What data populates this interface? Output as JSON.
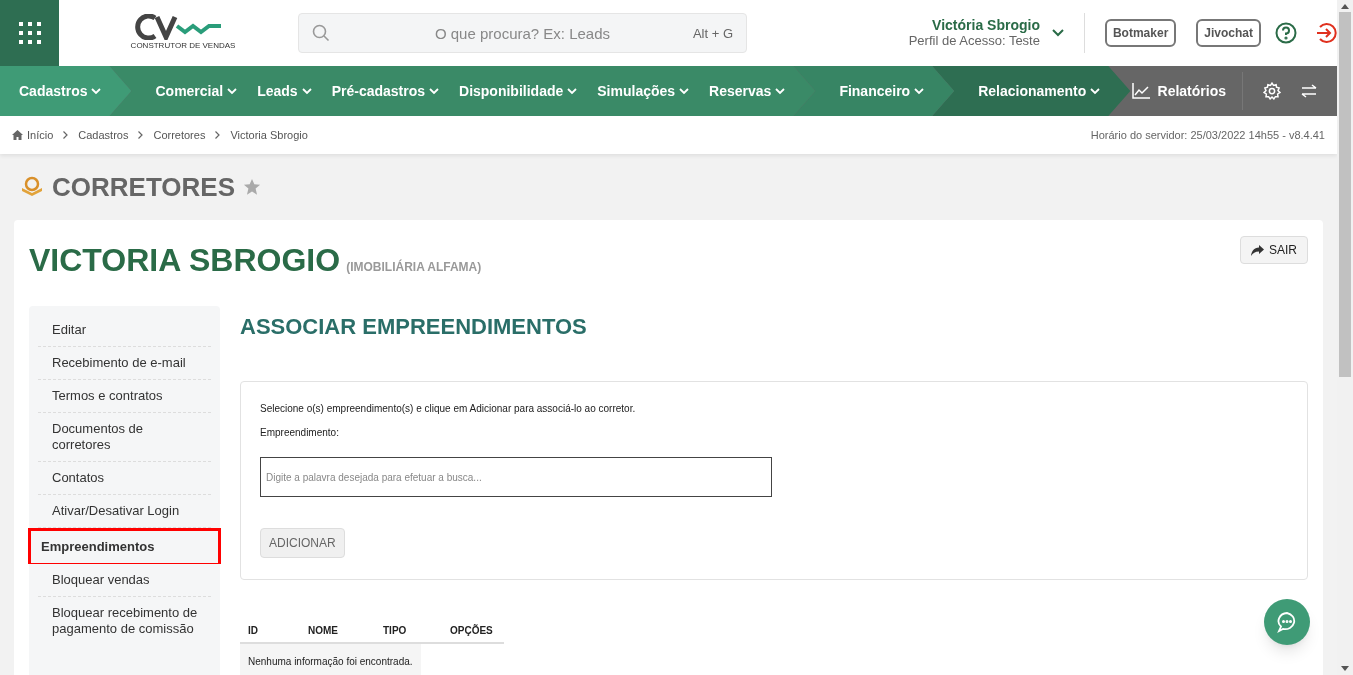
{
  "header": {
    "logo_tagline": "CONSTRUTOR DE VENDAS",
    "search": {
      "placeholder": "O que procura? Ex: Leads",
      "shortcut": "Alt + G"
    },
    "user": {
      "name": "Victória Sbrogio",
      "profile": "Perfil de Acesso: Teste"
    },
    "buttons": [
      "Botmaker",
      "Jivochat"
    ]
  },
  "nav": {
    "groups": [
      {
        "color": "#3f9b76",
        "items": [
          "Cadastros"
        ]
      },
      {
        "color": "#3a8a67",
        "items": [
          "Comercial",
          "Leads",
          "Pré-cadastros",
          "Disponibilidade",
          "Simulações",
          "Reservas"
        ]
      },
      {
        "color": "#378564",
        "items": [
          "Financeiro"
        ]
      },
      {
        "color": "#2e6e52",
        "items": [
          "Relacionamento"
        ]
      }
    ],
    "reports": "Relatórios"
  },
  "breadcrumb": [
    "Início",
    "Cadastros",
    "Corretores",
    "Victoria Sbrogio"
  ],
  "server_time": "Horário do servidor: 25/03/2022 14h55 - v8.4.41",
  "page_title": "CORRETORES",
  "record": {
    "name": "VICTORIA SBROGIO",
    "company": "(IMOBILIÁRIA ALFAMA)",
    "exit_button": "SAIR"
  },
  "sidebar": {
    "items": [
      {
        "label": "Editar",
        "selected": false
      },
      {
        "label": "Recebimento de e-mail",
        "selected": false
      },
      {
        "label": "Termos e contratos",
        "selected": false
      },
      {
        "label": "Documentos de corretores",
        "selected": false
      },
      {
        "label": "Contatos",
        "selected": false
      },
      {
        "label": "Ativar/Desativar Login",
        "selected": false
      },
      {
        "label": "Empreendimentos",
        "selected": true
      },
      {
        "label": "Bloquear vendas",
        "selected": false
      },
      {
        "label": "Bloquear recebimento de pagamento de comissão",
        "selected": false
      }
    ]
  },
  "section": {
    "title": "ASSOCIAR EMPREENDIMENTOS",
    "instructions": "Selecione o(s) empreendimento(s) e clique em Adicionar para associá-lo ao corretor.",
    "field_label": "Empreendimento:",
    "field": {
      "placeholder": "Digite a palavra desejada para efetuar a busca..."
    },
    "add_button": "ADICIONAR"
  },
  "table": {
    "columns": [
      "ID",
      "NOME",
      "TIPO",
      "OPÇÕES"
    ],
    "empty_message": "Nenhuma informação foi encontrada."
  }
}
